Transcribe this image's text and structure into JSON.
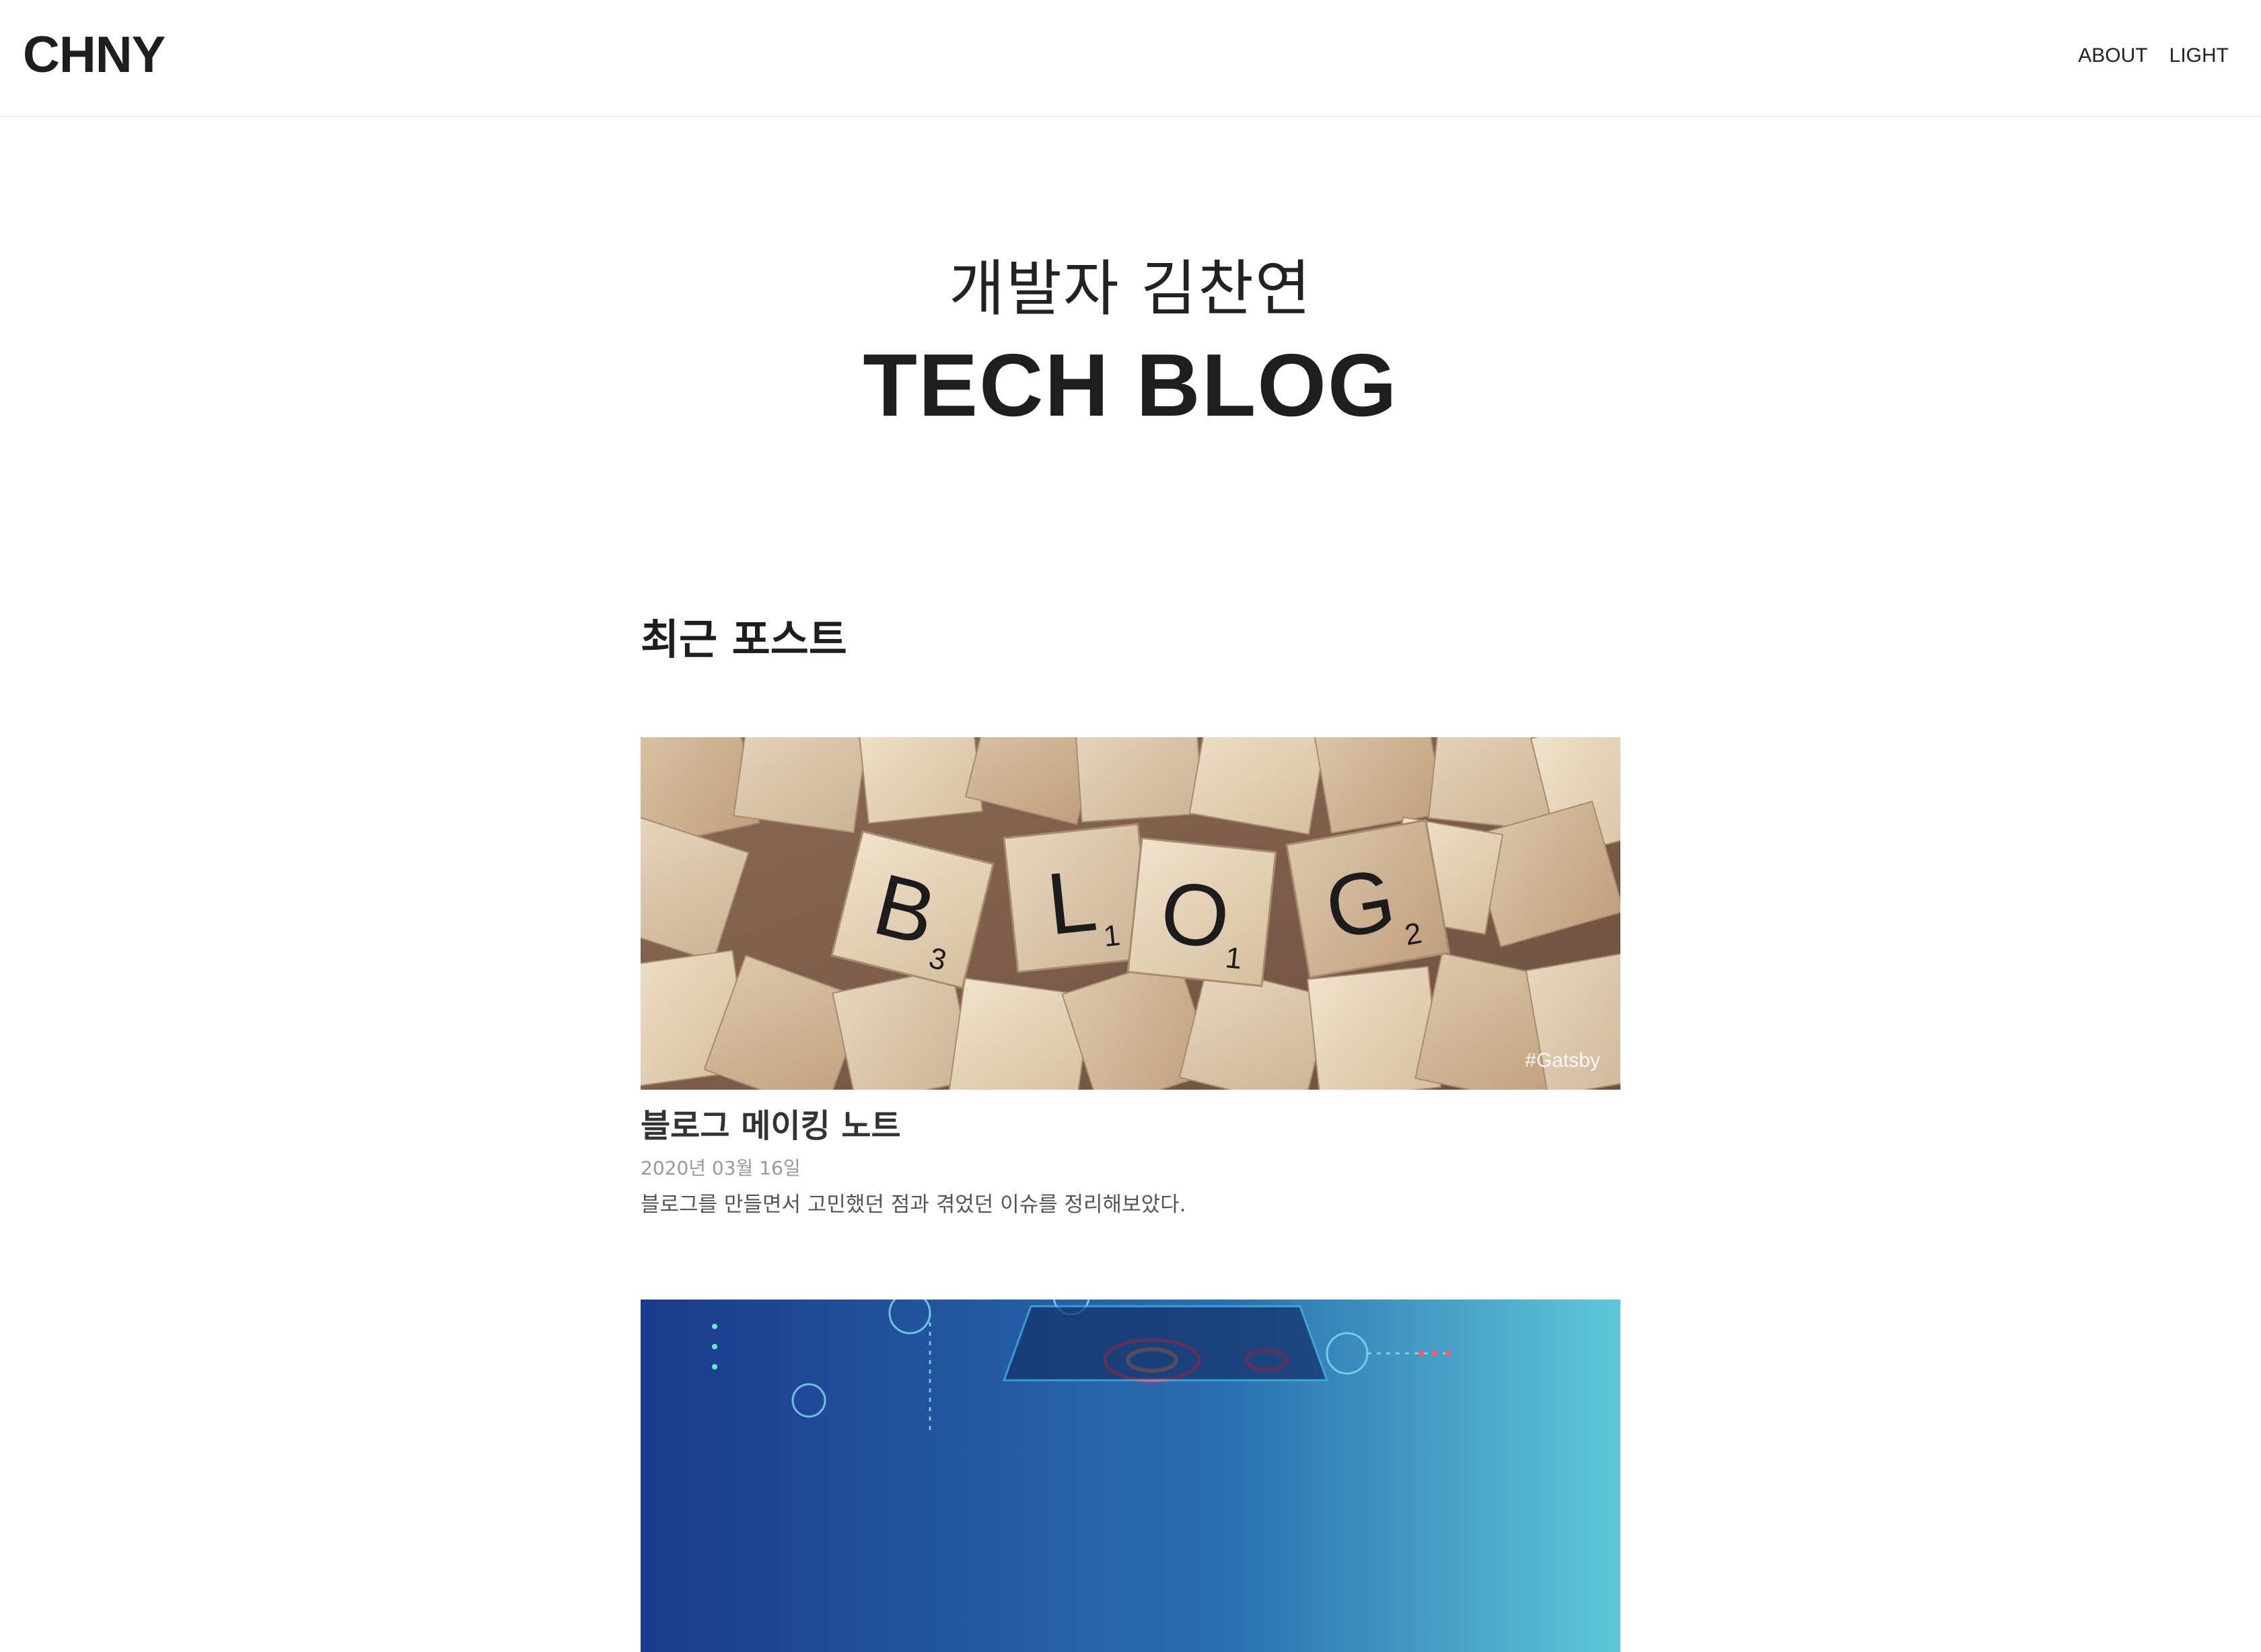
{
  "header": {
    "logo": "CHNY",
    "nav": [
      {
        "label": "ABOUT"
      },
      {
        "label": "LIGHT"
      }
    ]
  },
  "hero": {
    "subtitle": "개발자 김찬연",
    "title": "TECH BLOG"
  },
  "main": {
    "section_title": "최근 포스트",
    "posts": [
      {
        "title": "블로그 메이킹 노트",
        "date": "2020년 03월 16일",
        "description": "블로그를 만들면서 고민했던 점과 겪었던 이슈를 정리해보았다.",
        "tag": "#Gatsby",
        "tiles": [
          {
            "letter": "B",
            "score": "3"
          },
          {
            "letter": "L",
            "score": "1"
          },
          {
            "letter": "O",
            "score": "1"
          },
          {
            "letter": "G",
            "score": "2"
          }
        ]
      },
      {
        "title": "",
        "date": "",
        "description": "",
        "tag": ""
      }
    ]
  },
  "colors": {
    "text_primary": "#1e1e1e",
    "text_date": "#999999",
    "text_desc": "#555555",
    "header_border": "#ececec",
    "second_thumb_gradient": [
      "#1b3a8c",
      "#2a6fb0",
      "#5fc8d8"
    ]
  }
}
